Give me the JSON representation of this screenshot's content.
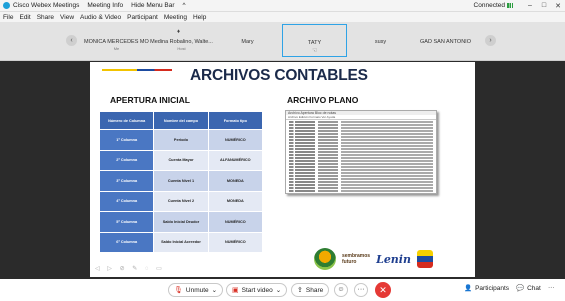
{
  "titlebar": {
    "app_title": "Cisco Webex Meetings",
    "meeting_info": "Meeting Info",
    "hide_menu_bar": "Hide Menu Bar",
    "chevron": "^",
    "connected": "Connected",
    "minimize": "–",
    "maximize": "□",
    "close": "✕"
  },
  "menu": [
    "File",
    "Edit",
    "Share",
    "View",
    "Audio & Video",
    "Participant",
    "Meeting",
    "Help"
  ],
  "participants": [
    {
      "name": "MONICA MERCEDES MO...",
      "role": "Me"
    },
    {
      "name": "Medina Robalino, Walte...",
      "role": "Host"
    },
    {
      "name": "Mary",
      "role": ""
    },
    {
      "name": "TATY",
      "role": ""
    },
    {
      "name": "susy",
      "role": ""
    },
    {
      "name": "GAD SAN ANTONIO",
      "role": ""
    }
  ],
  "strip_nav": {
    "prev": "‹",
    "next": "›"
  },
  "slide": {
    "title": "ARCHIVOS CONTABLES",
    "left_heading": "APERTURA INICIAL",
    "right_heading": "ARCHIVO PLANO",
    "table_headers": [
      "Número de Columna",
      "Nombre del campo",
      "Formato tipo"
    ],
    "table_rows": [
      [
        "1ª Columna",
        "Periodo",
        "NUMÉRICO"
      ],
      [
        "2ª Columna",
        "Cuenta Mayor",
        "ALFANUMÉRICO"
      ],
      [
        "3ª Columna",
        "Cuenta Nivel 1",
        "MONEDA"
      ],
      [
        "4ª Columna",
        "Cuenta Nivel 2",
        "MONEDA"
      ],
      [
        "5ª Columna",
        "Saldo Inicial Deudor",
        "NUMÉRICO"
      ],
      [
        "6ª Columna",
        "Saldo Inicial Acreedor",
        "NUMÉRICO"
      ]
    ],
    "plano_title": "Archivo Apertura Bloc de notas",
    "plano_menu": "Archivo   Edición   Formato   Ver   Ayuda",
    "plano_line_count": 34,
    "slide_controls": "◁ ▷ ⊘ ✎ ◌ ▭",
    "logo_sembramos_line1": "sembramos",
    "logo_sembramos_line2": "futuro",
    "logo_lenin": "Lenin",
    "stripe_colors": [
      "#f2c300",
      "#1d4ba0",
      "#d52b1e"
    ]
  },
  "controls": {
    "unmute": "Unmute",
    "start_video": "Start video",
    "share": "Share",
    "emoji_icon": "☺",
    "more": "···",
    "end": "✕",
    "participants": "Participants",
    "chat": "Chat",
    "more_right": "···"
  },
  "colors": {
    "active_border": "#2fa3e6",
    "end_red": "#e53935",
    "table_header": "#3b66b0"
  }
}
